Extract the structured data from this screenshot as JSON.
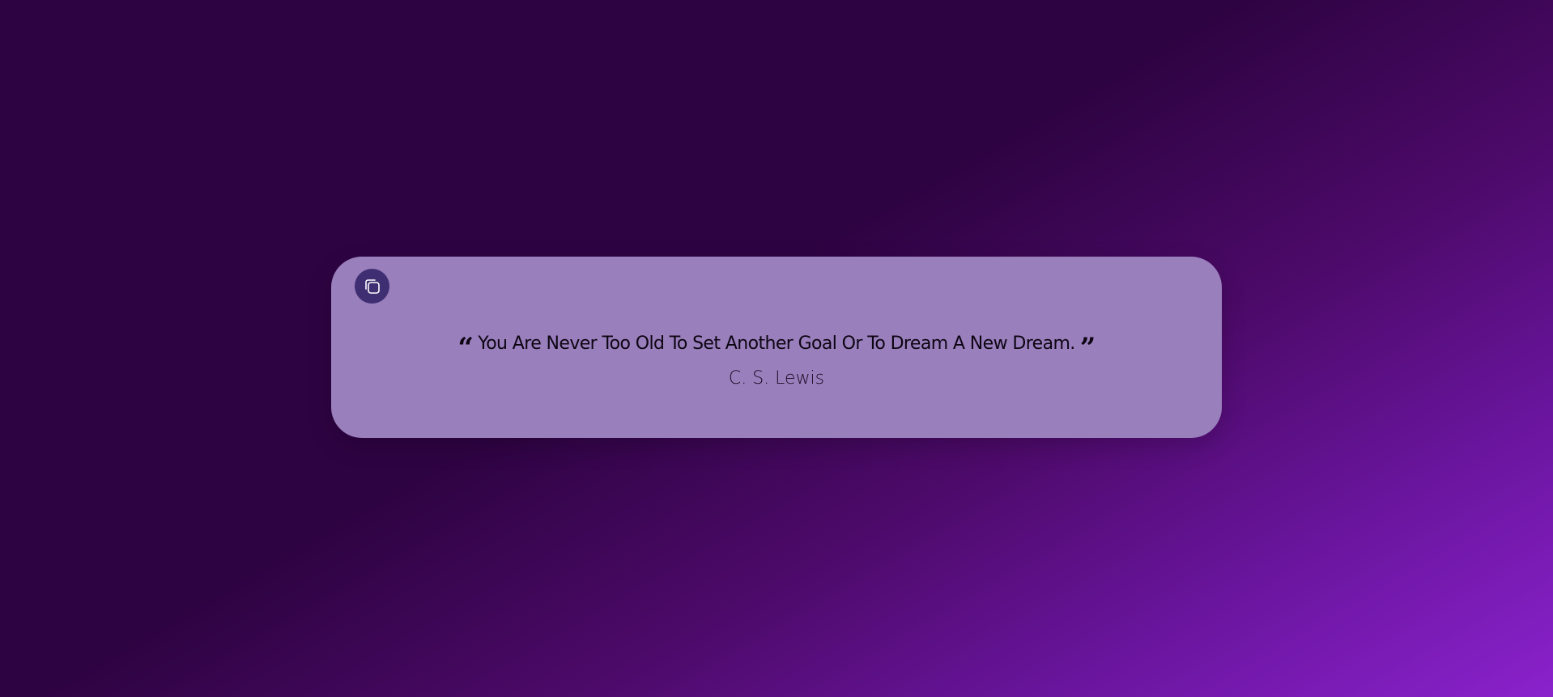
{
  "quote": {
    "open_mark": "“",
    "text": "You Are Never Too Old To Set Another Goal Or To Dream A New Dream.",
    "close_mark": "”",
    "author": "C. S. Lewis"
  },
  "copy_button": {
    "icon": "copy-icon"
  },
  "colors": {
    "card_background": "#9a7fbd",
    "button_background": "#3f2f72",
    "gradient_start": "#2e0342",
    "gradient_end": "#8a22cc"
  }
}
